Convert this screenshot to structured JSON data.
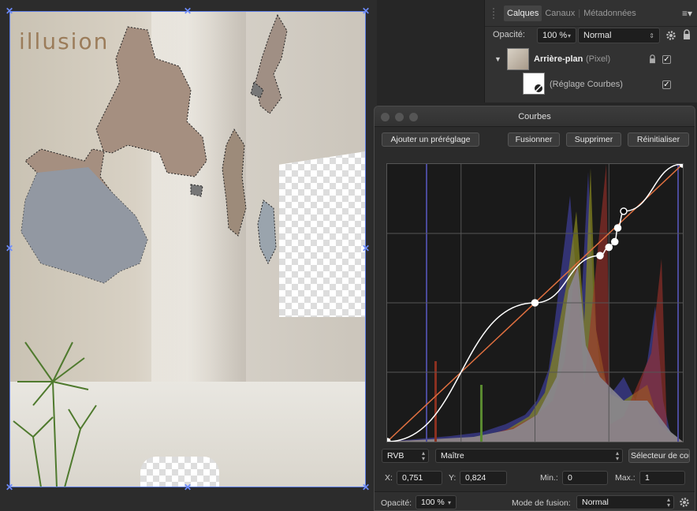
{
  "document": {
    "watermark": "illusion"
  },
  "layers_panel": {
    "tabs": [
      "Calques",
      "Canaux",
      "Métadonnées"
    ],
    "opacity_label": "Opacité:",
    "opacity_value": "100 %",
    "blend_mode": "Normal",
    "layers": [
      {
        "name": "Arrière-plan",
        "type": "(Pixel)",
        "checked": "✓"
      },
      {
        "name": "(Réglage Courbes)",
        "checked": "✓"
      }
    ]
  },
  "curves": {
    "title": "Courbes",
    "buttons": {
      "add_preset": "Ajouter un préréglage",
      "merge": "Fusionner",
      "delete": "Supprimer",
      "reset": "Réinitialiser"
    },
    "color_space": "RVB",
    "channel": "Maître",
    "picker": "Sélecteur de couleur",
    "x_label": "X:",
    "x_value": "0,751",
    "y_label": "Y:",
    "y_value": "0,824",
    "min_label": "Min.:",
    "min_value": "0",
    "max_label": "Max.:",
    "max_value": "1",
    "opacity_label": "Opacité:",
    "opacity_value": "100 %",
    "blend_label": "Mode de fusion:",
    "blend_value": "Normal",
    "curve_points": [
      [
        0,
        0
      ],
      [
        0.5,
        0.5
      ],
      [
        0.72,
        0.67
      ],
      [
        0.75,
        0.7
      ],
      [
        0.77,
        0.72
      ],
      [
        0.78,
        0.77
      ],
      [
        0.8,
        0.83
      ],
      [
        1,
        1
      ]
    ],
    "colors": {
      "curve": "#ffffff",
      "diagonal": "#e07040",
      "grid": "#555555",
      "selected_point": "#000000"
    }
  }
}
